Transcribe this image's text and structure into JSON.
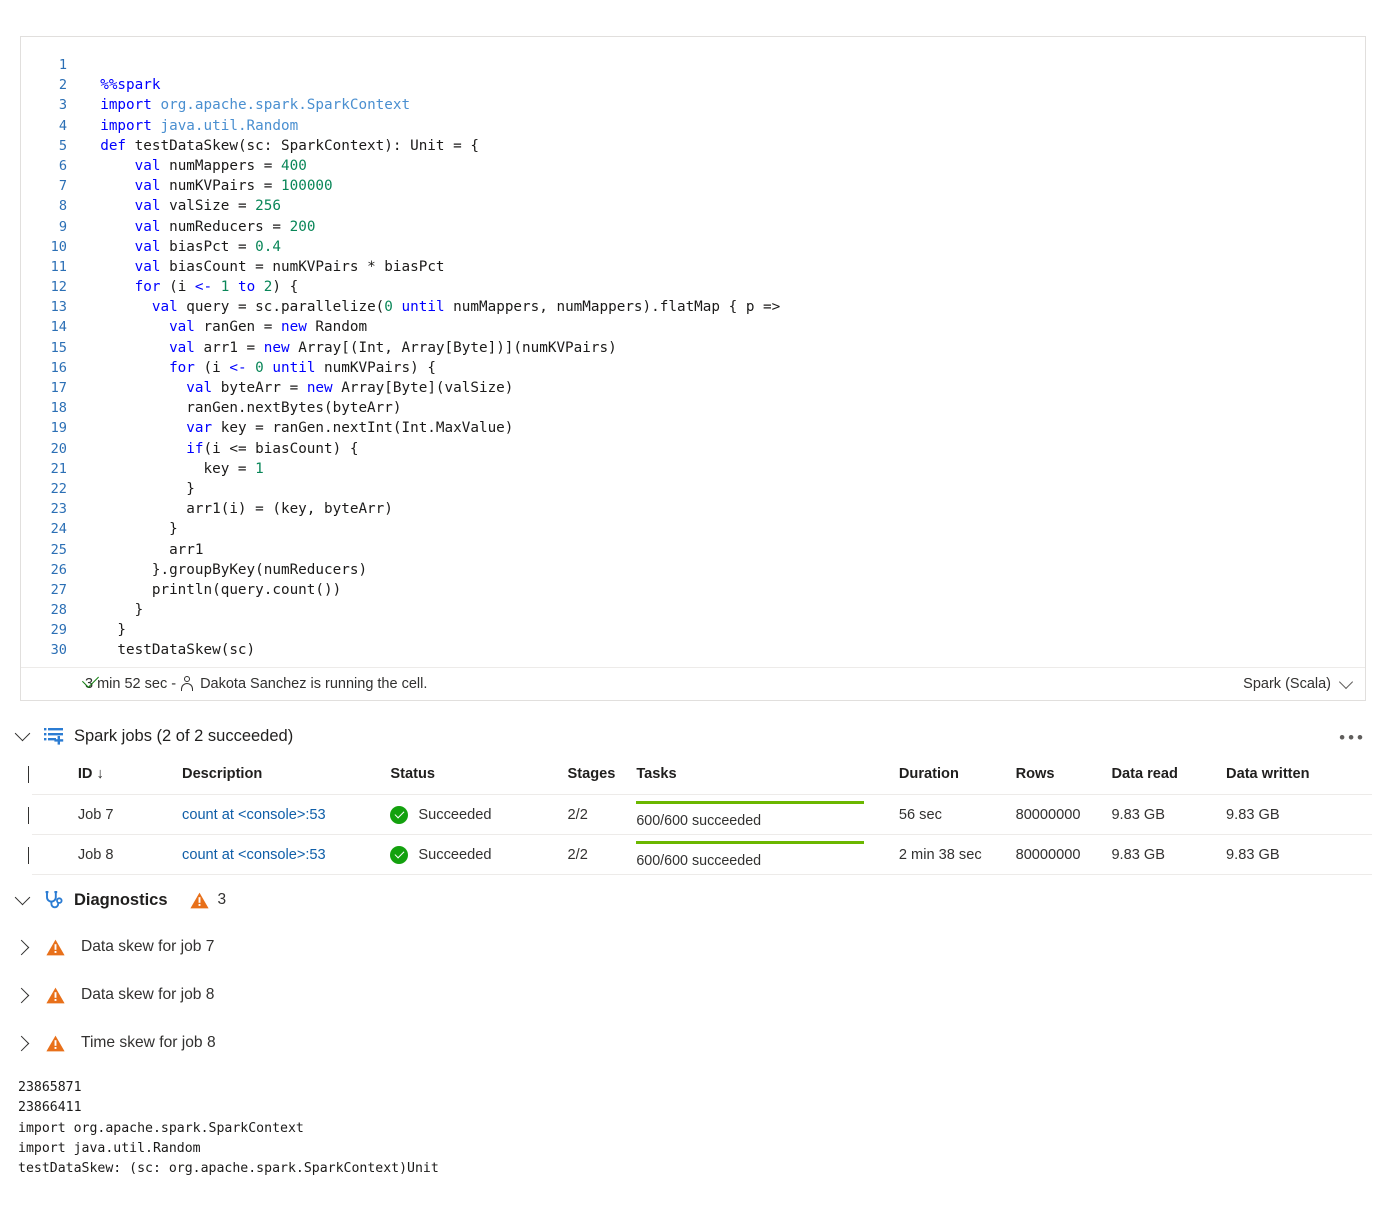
{
  "cell": {
    "kernel_label": "Spark (Scala)",
    "status": {
      "duration": "3 min 52 sec -",
      "user_message": "Dakota Sanchez is running the cell."
    },
    "code_lines": [
      {
        "n": "1",
        "html": ""
      },
      {
        "n": "2",
        "html": "  <span class=\"kw\">%%spark</span>"
      },
      {
        "n": "3",
        "html": "  <span class=\"kw\">import</span> <span class=\"ns\">org.apache.spark.SparkContext</span>"
      },
      {
        "n": "4",
        "html": "  <span class=\"kw\">import</span> <span class=\"ns\">java.util.Random</span>"
      },
      {
        "n": "5",
        "html": "  <span class=\"kw\">def</span> testDataSkew(sc: SparkContext): Unit = {"
      },
      {
        "n": "6",
        "html": "      <span class=\"kw\">val</span> numMappers = <span class=\"num\">400</span>"
      },
      {
        "n": "7",
        "html": "      <span class=\"kw\">val</span> numKVPairs = <span class=\"num\">100000</span>"
      },
      {
        "n": "8",
        "html": "      <span class=\"kw\">val</span> valSize = <span class=\"num\">256</span>"
      },
      {
        "n": "9",
        "html": "      <span class=\"kw\">val</span> numReducers = <span class=\"num\">200</span>"
      },
      {
        "n": "10",
        "html": "      <span class=\"kw\">val</span> biasPct = <span class=\"num\">0.4</span>"
      },
      {
        "n": "11",
        "html": "      <span class=\"kw\">val</span> biasCount = numKVPairs * biasPct"
      },
      {
        "n": "12",
        "html": "      <span class=\"kw\">for</span> (i <span class=\"kw\">&lt;-</span> <span class=\"num\">1</span> <span class=\"kw\">to</span> <span class=\"num\">2</span>) {"
      },
      {
        "n": "13",
        "html": "        <span class=\"kw\">val</span> query = sc.parallelize(<span class=\"num\">0</span> <span class=\"kw\">until</span> numMappers, numMappers).flatMap { p =&gt;"
      },
      {
        "n": "14",
        "html": "          <span class=\"kw\">val</span> ranGen = <span class=\"kw\">new</span> Random"
      },
      {
        "n": "15",
        "html": "          <span class=\"kw\">val</span> arr1 = <span class=\"kw\">new</span> Array[(Int, Array[Byte])](numKVPairs)"
      },
      {
        "n": "16",
        "html": "          <span class=\"kw\">for</span> (i <span class=\"kw\">&lt;-</span> <span class=\"num\">0</span> <span class=\"kw\">until</span> numKVPairs) {"
      },
      {
        "n": "17",
        "html": "            <span class=\"kw\">val</span> byteArr = <span class=\"kw\">new</span> Array[Byte](valSize)"
      },
      {
        "n": "18",
        "html": "            ranGen.nextBytes(byteArr)"
      },
      {
        "n": "19",
        "html": "            <span class=\"kw\">var</span> key = ranGen.nextInt(Int.MaxValue)"
      },
      {
        "n": "20",
        "html": "            <span class=\"kw\">if</span>(i &lt;= biasCount) {"
      },
      {
        "n": "21",
        "html": "              key = <span class=\"num\">1</span>"
      },
      {
        "n": "22",
        "html": "            }"
      },
      {
        "n": "23",
        "html": "            arr1(i) = (key, byteArr)"
      },
      {
        "n": "24",
        "html": "          }"
      },
      {
        "n": "25",
        "html": "          arr1"
      },
      {
        "n": "26",
        "html": "        }.groupByKey(numReducers)"
      },
      {
        "n": "27",
        "html": "        println(query.count())"
      },
      {
        "n": "28",
        "html": "      }"
      },
      {
        "n": "29",
        "html": "    }"
      },
      {
        "n": "30",
        "html": "    testDataSkew(sc)"
      }
    ]
  },
  "spark_jobs": {
    "title": "Spark jobs (2 of 2 succeeded)",
    "more_label": "•••",
    "columns": [
      "ID ↓",
      "Description",
      "Status",
      "Stages",
      "Tasks",
      "Duration",
      "Rows",
      "Data read",
      "Data written"
    ],
    "rows": [
      {
        "id": "Job 7",
        "description": "count at <console>:53",
        "status": "Succeeded",
        "stages": "2/2",
        "tasks": "600/600 succeeded",
        "tasks_progress": 100,
        "duration": "56 sec",
        "rows": "80000000",
        "data_read": "9.83 GB",
        "data_written": "9.83 GB"
      },
      {
        "id": "Job 8",
        "description": "count at <console>:53",
        "status": "Succeeded",
        "stages": "2/2",
        "tasks": "600/600 succeeded",
        "tasks_progress": 100,
        "duration": "2 min 38 sec",
        "rows": "80000000",
        "data_read": "9.83 GB",
        "data_written": "9.83 GB"
      }
    ]
  },
  "diagnostics": {
    "title": "Diagnostics",
    "warning_count": "3",
    "items": [
      {
        "label": "Data skew for job 7"
      },
      {
        "label": "Data skew for job 8"
      },
      {
        "label": "Time skew for job 8"
      }
    ]
  },
  "output": {
    "lines": [
      "23865871",
      "23866411",
      "import org.apache.spark.SparkContext",
      "import java.util.Random",
      "testDataSkew: (sc: org.apache.spark.SparkContext)Unit"
    ]
  },
  "colors": {
    "accent": "#0f5ea8",
    "success": "#13a10e",
    "progress": "#6bb700",
    "warning": "#e8701a",
    "keyword": "#0000ff",
    "number": "#098658",
    "namespace": "#4a8fd0",
    "gutter": "#2b6fb5"
  }
}
